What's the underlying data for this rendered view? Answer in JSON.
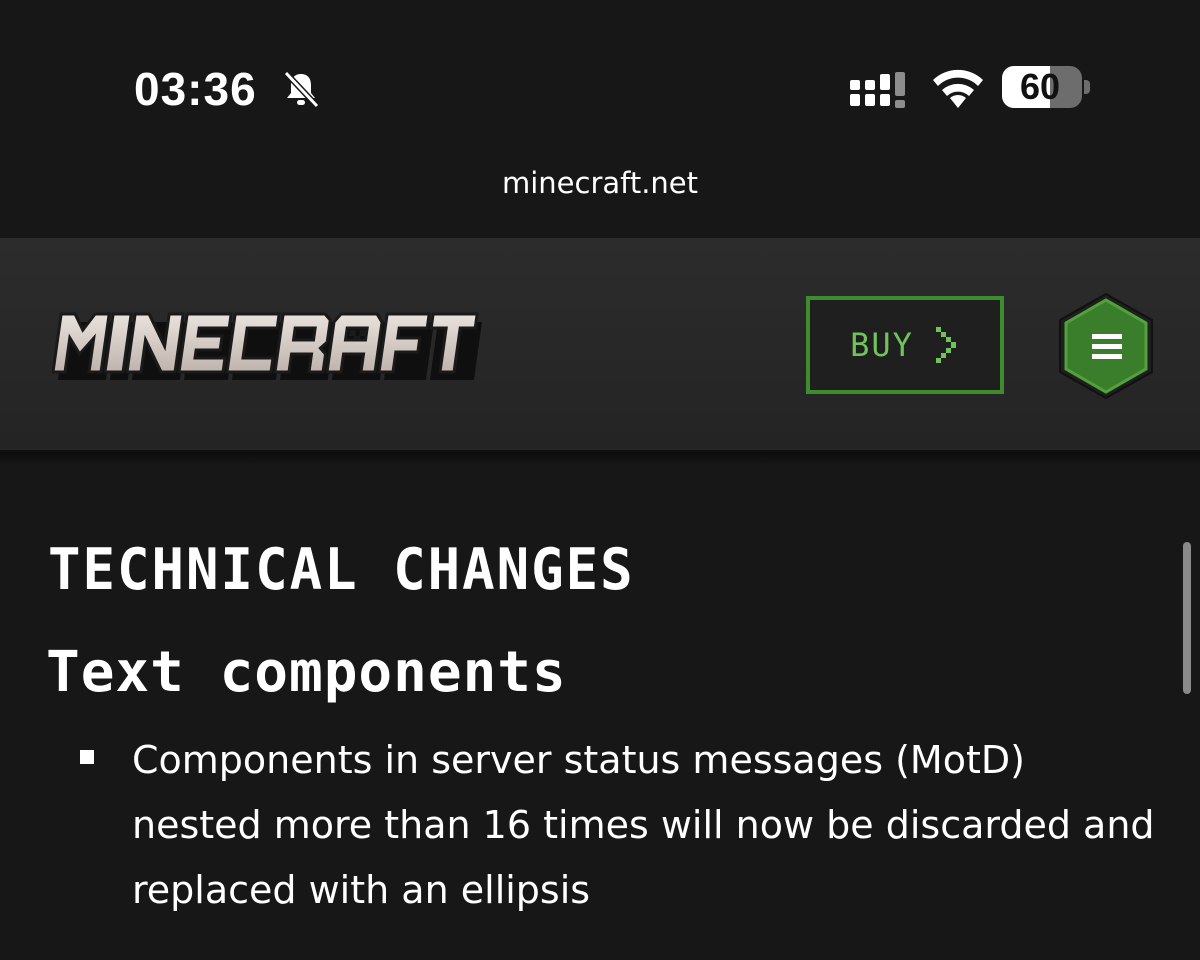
{
  "status_bar": {
    "time": "03:36",
    "battery_level": "60",
    "battery_fraction": 0.6,
    "icons": [
      "bell-muted-icon",
      "cellular-signal-icon",
      "wifi-icon",
      "battery-icon"
    ]
  },
  "browser": {
    "url": "minecraft.net"
  },
  "header": {
    "logo_text": "MINECRAFT",
    "buy_label": "BUY",
    "menu_icon": "hamburger-icon"
  },
  "content": {
    "section_heading": "TECHNICAL CHANGES",
    "sub_heading": "Text components",
    "bullets": [
      "Components in server status messages (MotD) nested more than 16 times will now be discarded and replaced with an ellipsis"
    ]
  },
  "colors": {
    "background": "#171717",
    "header": "#2a2a2a",
    "accent_green": "#3f8c2e",
    "buy_text": "#6fc35a"
  }
}
